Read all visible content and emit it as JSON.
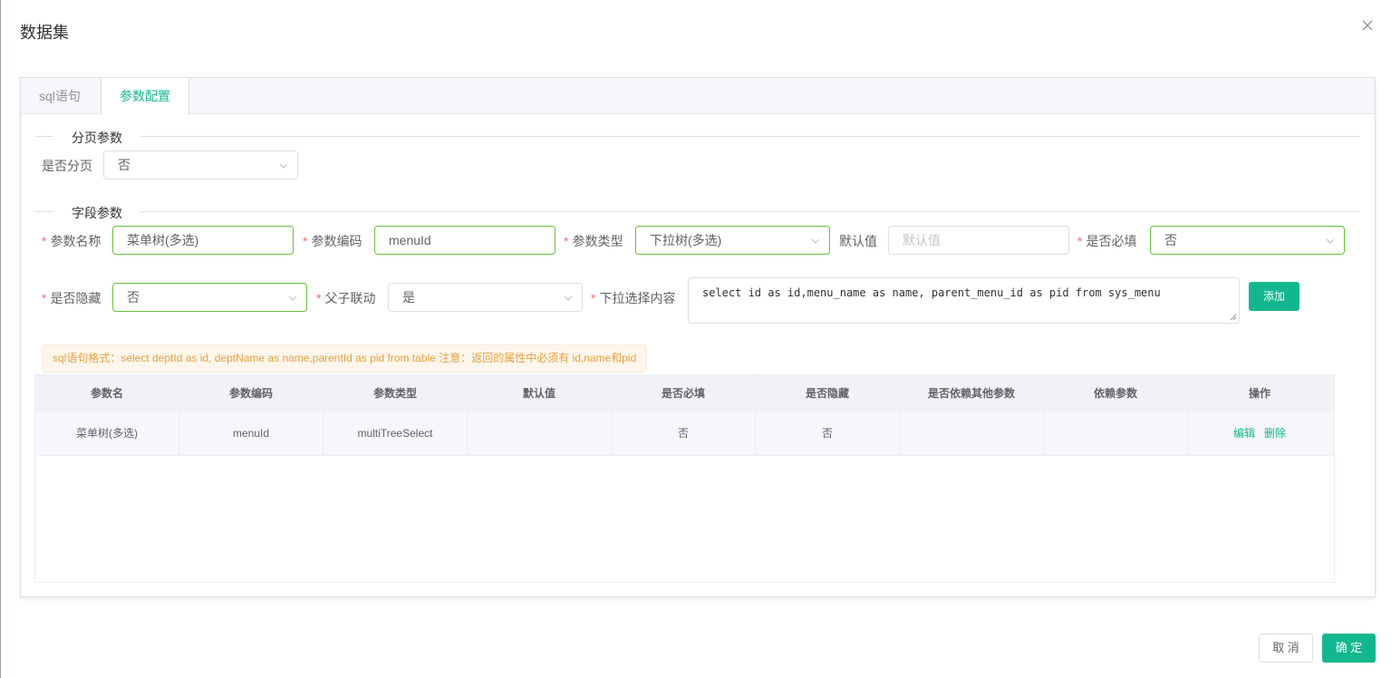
{
  "dialog": {
    "title": "数据集"
  },
  "tabs": [
    {
      "label": "sql语句",
      "active": false
    },
    {
      "label": "参数配置",
      "active": true
    }
  ],
  "paging": {
    "section_title": "分页参数",
    "is_paging_label": "是否分页",
    "is_paging_value": "否"
  },
  "fields": {
    "section_title": "字段参数",
    "param_name_label": "参数名称",
    "param_name_value": "菜单树(多选)",
    "param_code_label": "参数编码",
    "param_code_value": "menuId",
    "param_type_label": "参数类型",
    "param_type_value": "下拉树(多选)",
    "default_label": "默认值",
    "default_placeholder": "默认值",
    "required_label": "是否必填",
    "required_value": "否",
    "hidden_label": "是否隐藏",
    "hidden_value": "否",
    "linkage_label": "父子联动",
    "linkage_value": "是",
    "dropdown_label": "下拉选择内容",
    "dropdown_value": "select id as id,menu_name as name, parent_menu_id as pid from sys_menu",
    "add_button": "添加"
  },
  "hint": "sql语句格式：select deptId as id, deptName as name,parentId as pid from table 注意：返回的属性中必须有 id,name和pid",
  "table": {
    "headers": [
      "参数名",
      "参数编码",
      "参数类型",
      "默认值",
      "是否必填",
      "是否隐藏",
      "是否依赖其他参数",
      "依赖参数",
      "操作"
    ],
    "rows": [
      [
        "菜单树(多选)",
        "menuId",
        "multiTreeSelect",
        "",
        "否",
        "否",
        "",
        ""
      ]
    ],
    "edit_label": "编辑",
    "delete_label": "删除"
  },
  "footer": {
    "cancel": "取 消",
    "confirm": "确 定"
  },
  "colors": {
    "accent": "#13b78f",
    "required": "#f56c6c",
    "warning": "#e6a23c",
    "valid_border": "#67c23a"
  }
}
